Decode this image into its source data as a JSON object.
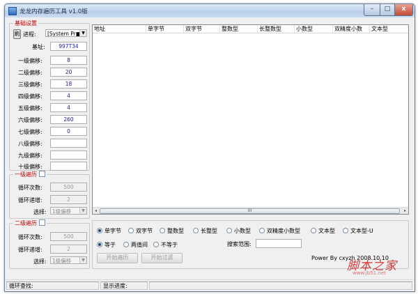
{
  "window": {
    "title": "龙龙内存遍历工具 v1.0版",
    "min": "–",
    "max": "□",
    "close": "x"
  },
  "base_settings": {
    "legend": "基础设置",
    "refresh_button": "刷",
    "process_label": "进程:",
    "process_value": "[System Pr■",
    "base_label": "基址:",
    "base_value": "997T34",
    "offsets": [
      {
        "label": "一级偏移:",
        "value": "8"
      },
      {
        "label": "二级偏移:",
        "value": "20"
      },
      {
        "label": "三级偏移:",
        "value": "18"
      },
      {
        "label": "四级偏移:",
        "value": "4"
      },
      {
        "label": "五级偏移:",
        "value": "4"
      },
      {
        "label": "六级偏移:",
        "value": "260"
      },
      {
        "label": "七级偏移:",
        "value": "0"
      },
      {
        "label": "八级偏移:",
        "value": ""
      },
      {
        "label": "九级偏移:",
        "value": ""
      },
      {
        "label": "十级偏移:",
        "value": ""
      }
    ]
  },
  "level1": {
    "legend": "一级遍历",
    "loop_count_label": "循环次数:",
    "loop_count_value": "500",
    "loop_inc_label": "循环递增:",
    "loop_inc_value": "2",
    "select_label": "选择:",
    "select_value": "1级偏移"
  },
  "level2": {
    "legend": "二级遍历",
    "loop_count_label": "循环次数:",
    "loop_count_value": "500",
    "loop_inc_label": "循环递增:",
    "loop_inc_value": "2",
    "select_label": "选择:",
    "select_value": "1级偏移"
  },
  "list": {
    "columns": [
      "地址",
      "单字节",
      "双字节",
      "整数型",
      "长整数型",
      "小数型",
      "双精度小数",
      "文本型"
    ],
    "scroll_thumb": "III",
    "left_arrow": "◂",
    "right_arrow": "▸"
  },
  "search": {
    "types": [
      "单字节",
      "双字节",
      "整数型",
      "长整型",
      "小数型",
      "双精度小数型",
      "文本型",
      "文本型-U"
    ],
    "selected_type": 0,
    "compare": [
      "等于",
      "两值间",
      "不等于"
    ],
    "selected_compare": 0,
    "range_label": "搜索范围:",
    "range_value": "",
    "start_button": "开始遍历",
    "filter_button": "开始过滤",
    "powered_by": "Power By cxyzh 2008.10.10"
  },
  "status": {
    "loop_search": "循环查找:",
    "progress": "显示进度:"
  },
  "watermark": {
    "text": "脚本之家",
    "url": "www.jb51.net"
  }
}
